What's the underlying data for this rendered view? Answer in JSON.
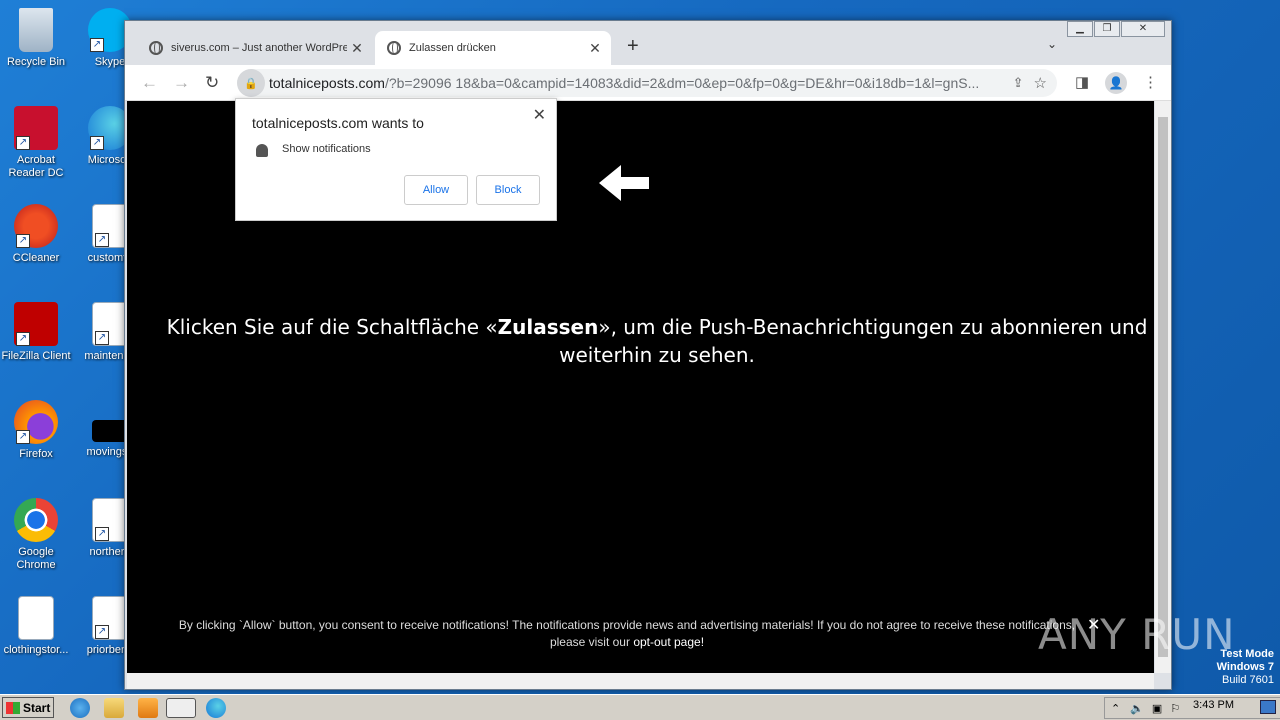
{
  "desktop": {
    "icons": [
      {
        "label": "Recycle Bin"
      },
      {
        "label": "Skype"
      },
      {
        "label": "Acrobat Reader DC"
      },
      {
        "label": "Microsoft"
      },
      {
        "label": "CCleaner"
      },
      {
        "label": "customte"
      },
      {
        "label": "FileZilla Client"
      },
      {
        "label": "maintenan"
      },
      {
        "label": "Firefox"
      },
      {
        "label": "movingsu"
      },
      {
        "label": "Google Chrome"
      },
      {
        "label": "northern"
      },
      {
        "label": "clothingstor..."
      },
      {
        "label": "priorbene"
      }
    ]
  },
  "browser": {
    "tabs": [
      {
        "title": "siverus.com – Just another WordPre",
        "active": false
      },
      {
        "title": "Zulassen drücken",
        "active": true
      }
    ],
    "url_host": "totalniceposts.com",
    "url_rest": "/?b=29096 18&ba=0&campid=14083&did=2&dm=0&ep=0&fp=0&g=DE&hr=0&i18db=1&l=gnS..."
  },
  "permission_popup": {
    "title": "totalniceposts.com wants to",
    "permission": "Show notifications",
    "allow_label": "Allow",
    "block_label": "Block"
  },
  "page": {
    "headline_pre": "Klicken Sie auf die Schaltfläche «",
    "headline_bold": "Zulassen",
    "headline_post": "», um die Push-Benachrichtigungen zu abonnieren und weiterhin zu sehen.",
    "footer_line1": "By clicking `Allow` button, you consent to receive notifications! The notifications provide news and advertising materials! If you do not agree to receive these notifications,",
    "footer_line2": "please visit our ",
    "footer_link": "opt-out page!"
  },
  "watermark": {
    "text": "ANY RUN",
    "mode": "Test Mode",
    "os": "Windows 7",
    "build": "Build 7601"
  },
  "taskbar": {
    "start_label": "Start",
    "clock": "3:43 PM"
  }
}
